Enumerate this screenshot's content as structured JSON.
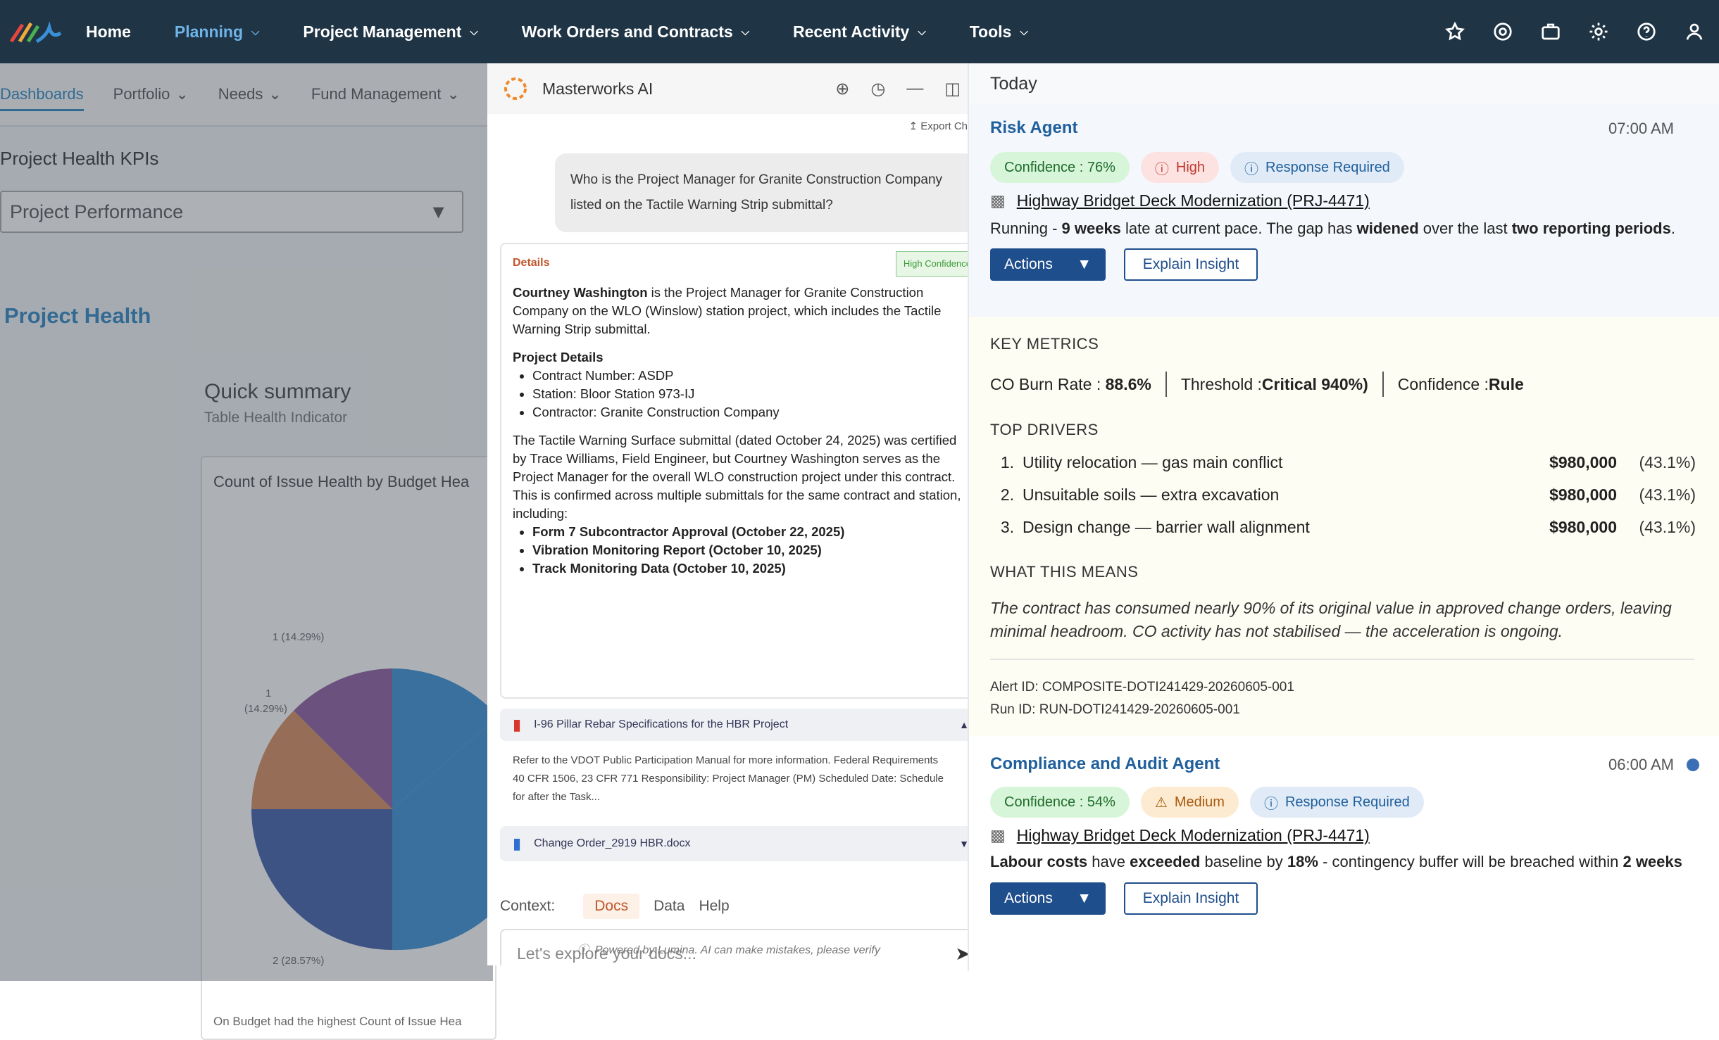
{
  "topnav": {
    "items": [
      "Home",
      "Planning",
      "Project Management",
      "Work Orders and Contracts",
      "Recent Activity",
      "Tools"
    ],
    "active": "Planning"
  },
  "subnav": {
    "items": [
      "Dashboards",
      "Portfolio",
      "Needs",
      "Fund Management"
    ]
  },
  "dashboard": {
    "kpi_title": "Project Health KPIs",
    "dropdown_value": "Project Performance",
    "section": "Project Health",
    "quick_summary": "Quick summary",
    "quick_sub": "Table Health Indicator",
    "chart_title": "Count of Issue Health by Budget Hea",
    "chart_footer": "On Budget had the highest Count of Issue Hea",
    "labels": [
      "1 (14.29%)",
      "1",
      "(14.29%)",
      "2 (28.57%)"
    ]
  },
  "chat": {
    "title": "Masterworks AI",
    "export": "Export Ch",
    "question": "Who is the Project Manager for Granite Construction Company listed on the Tactile Warning Strip submittal?",
    "details_label": "Details",
    "confidence_badge": "High Confidence",
    "answer_name": "Courtney Washington",
    "answer_rest": " is the Project Manager for Granite Construction Company on the WLO (Winslow) station project, which includes the Tactile Warning Strip submittal.",
    "pd_title": "Project Details",
    "pd_items": [
      "Contract Number: ASDP",
      "Station: Bloor Station 973-IJ",
      "Contractor: Granite Construction Company"
    ],
    "para": "The Tactile Warning Surface submittal (dated October 24, 2025) was certified by Trace Williams, Field Engineer, but Courtney Washington serves as the Project Manager for the overall WLO construction project under this contract. This is confirmed across multiple submittals for the same contract and station, including:",
    "bold_items": [
      "Form 7 Subcontractor Approval (October 22, 2025)",
      "Vibration Monitoring Report (October 10, 2025)",
      "Track Monitoring Data (October 10, 2025)"
    ],
    "attach1": "I-96 Pillar Rebar Specifications for the HBR Project",
    "attach1_body": "Refer to the VDOT Public Participation Manual for more information. Federal Requirements 40 CFR 1506, 23 CFR 771  Responsibility: Project Manager (PM) Scheduled Date: Schedule for after the Task...",
    "attach2": "Change Order_2919 HBR.docx",
    "context_label": "Context:",
    "context_tabs": [
      "Docs",
      "Data",
      "Help"
    ],
    "input_placeholder": "Let's explore your docs...",
    "powered": "Powered by Lumina. AI can make mistakes, please verify"
  },
  "panel": {
    "day": "Today",
    "card1": {
      "agent": "Risk Agent",
      "time": "07:00 AM",
      "confidence": "Confidence : 76%",
      "severity": "High",
      "response": "Response Required",
      "project": "Highway Bridget Deck Modernization (PRJ-4471)",
      "d1": "Running - ",
      "d2": "9 weeks",
      "d3": " late at current pace. The gap has ",
      "d4": "widened",
      "d5": " over the last ",
      "d6": "two reporting periods",
      "d7": ".",
      "actions": "Actions",
      "explain": "Explain Insight"
    },
    "metrics": {
      "title": "KEY METRICS",
      "m1_label": "CO Burn Rate : ",
      "m1_val": "88.6%",
      "m2_label": "Threshold : ",
      "m2_val": "Critical 940%)",
      "m3_label": "Confidence : ",
      "m3_val": "Rule",
      "drivers_title": "TOP DRIVERS",
      "drivers": [
        {
          "n": "1.",
          "t": "Utility relocation — gas main conflict",
          "amt": "$980,000",
          "pct": "(43.1%)"
        },
        {
          "n": "2.",
          "t": "Unsuitable soils — extra excavation",
          "amt": "$980,000",
          "pct": "(43.1%)"
        },
        {
          "n": "3.",
          "t": "Design change — barrier wall alignment",
          "amt": "$980,000",
          "pct": "(43.1%)"
        }
      ],
      "means_title": "WHAT THIS MEANS",
      "means": "The contract has consumed nearly 90% of its original value in approved change orders, leaving minimal headroom. CO activity has not stabilised — the acceleration is ongoing.",
      "alert_id": "Alert ID: COMPOSITE-DOTI241429-20260605-001",
      "run_id": "Run ID: RUN-DOTI241429-20260605-001"
    },
    "card2": {
      "agent": "Compliance and Audit Agent",
      "time": "06:00 AM",
      "confidence": "Confidence : 54%",
      "severity": "Medium",
      "response": "Response Required",
      "project": "Highway Bridget Deck Modernization (PRJ-4471)",
      "d1": "Labour costs",
      "d2": " have ",
      "d3": "exceeded",
      "d4": " baseline by ",
      "d5": "18%",
      "d6": " - contingency buffer will be breached within ",
      "d7": "2 weeks",
      "actions": "Actions",
      "explain": "Explain Insight"
    },
    "colors": {
      "accent": "#1f4e8c",
      "topnav": "#1f3445"
    }
  }
}
